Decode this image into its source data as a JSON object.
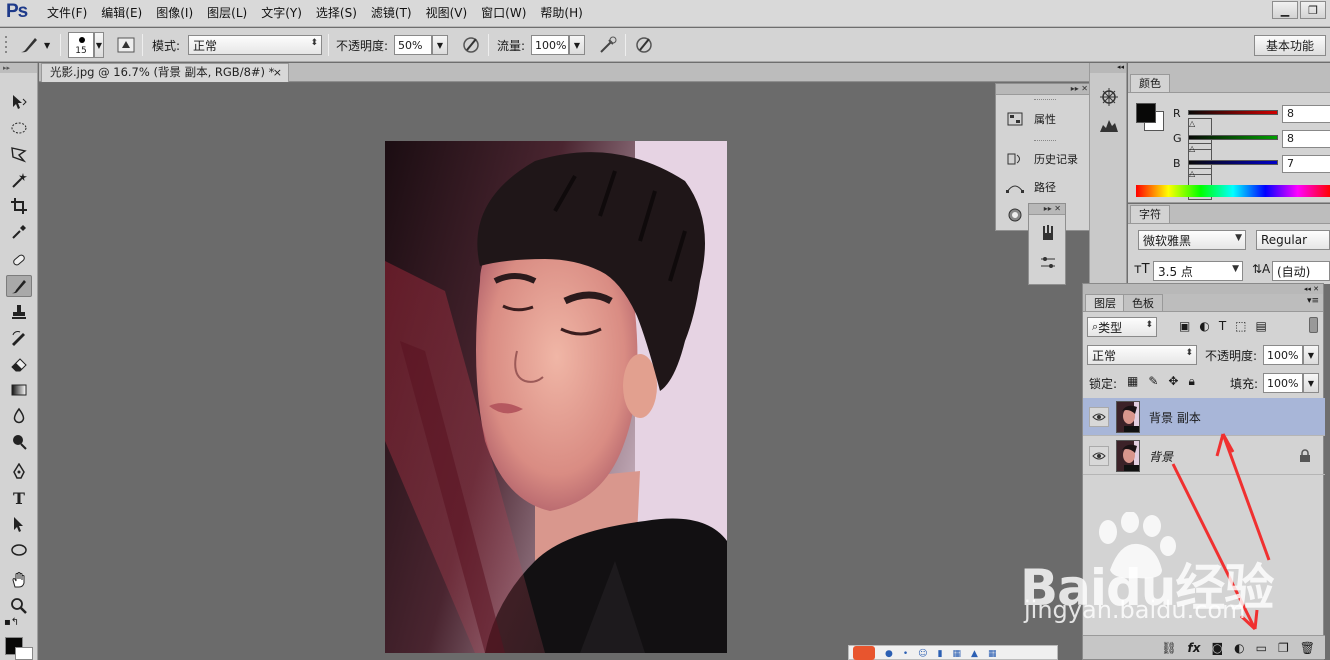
{
  "app": {
    "logo": "Ps"
  },
  "menu": [
    "文件(F)",
    "编辑(E)",
    "图像(I)",
    "图层(L)",
    "文字(Y)",
    "选择(S)",
    "滤镜(T)",
    "视图(V)",
    "窗口(W)",
    "帮助(H)"
  ],
  "window_buttons": [
    "▁",
    "❐"
  ],
  "options": {
    "brush_size": "15",
    "mode_label": "模式:",
    "mode_value": "正常",
    "opacity_label": "不透明度:",
    "opacity_value": "50%",
    "flow_label": "流量:",
    "flow_value": "100%",
    "workspace": "基本功能"
  },
  "document": {
    "tab_title": "光影.jpg @ 16.7% (背景 副本, RGB/8#) *",
    "close": "×"
  },
  "panels_float": {
    "properties": "属性",
    "history": "历史记录",
    "paths": "路径"
  },
  "color_panel": {
    "tab": "颜色",
    "channels": [
      {
        "label": "R",
        "value": "8",
        "color": "#d00000"
      },
      {
        "label": "G",
        "value": "8",
        "color": "#00a000"
      },
      {
        "label": "B",
        "value": "7",
        "color": "#0000c8"
      }
    ],
    "fg_color": "#080807",
    "bg_color": "#ffffff"
  },
  "char_panel": {
    "tab": "字符",
    "font_family": "微软雅黑",
    "font_style": "Regular",
    "font_size": "3.5 点",
    "leading": "(自动)"
  },
  "layers_panel": {
    "tabs": [
      "图层",
      "色板"
    ],
    "filter_type": "类型",
    "blend_mode": "正常",
    "opacity_label": "不透明度:",
    "opacity_value": "100%",
    "lock_label": "锁定:",
    "fill_label": "填充:",
    "fill_value": "100%",
    "layers": [
      {
        "name": "背景 副本",
        "selected": true
      },
      {
        "name": "背景",
        "selected": false,
        "locked": true
      }
    ],
    "bottom_icons": [
      "link-icon",
      "fx-icon",
      "mask-icon",
      "adjustment-icon",
      "folder-icon",
      "new-layer-icon",
      "trash-icon"
    ]
  },
  "watermark": {
    "logo": "Baidu经验",
    "url": "jingyan.baidu.com"
  }
}
